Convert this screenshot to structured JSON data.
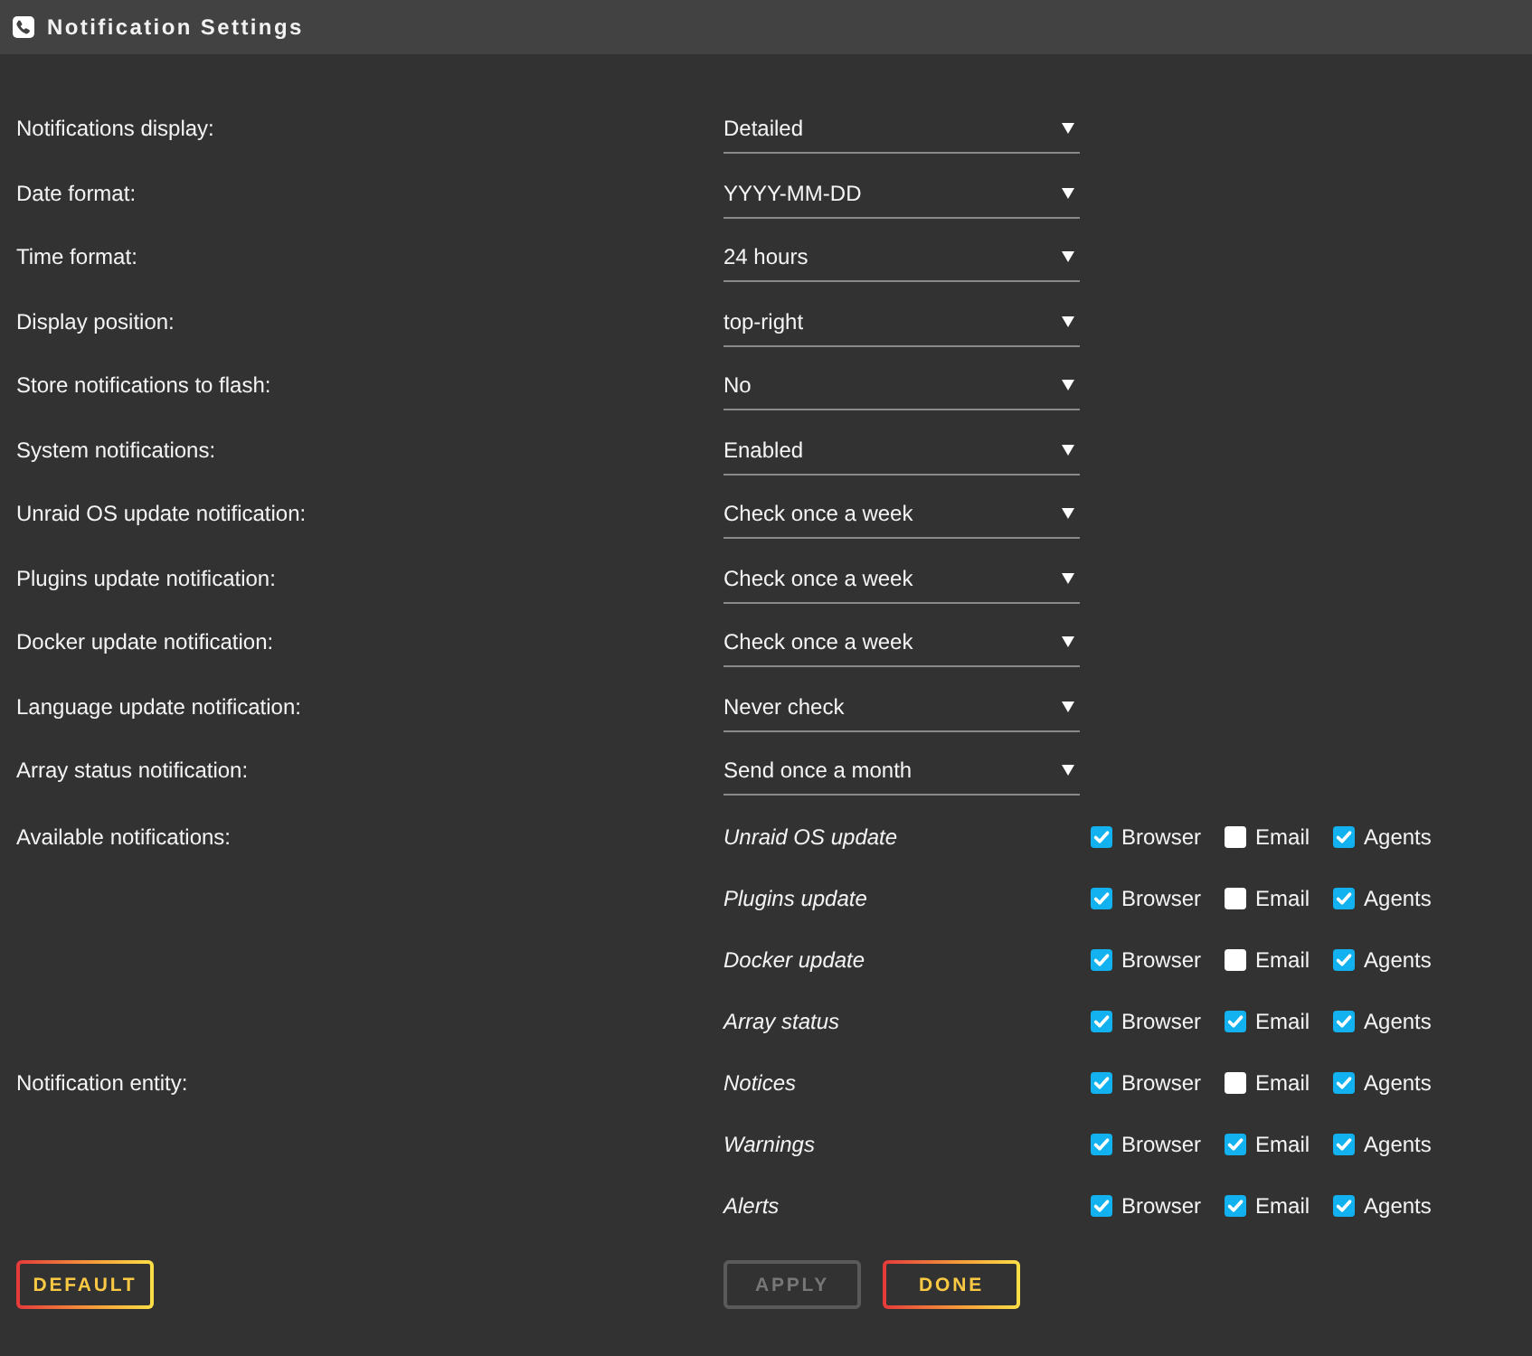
{
  "window": {
    "title": "Notification Settings"
  },
  "settings": [
    {
      "label": "Notifications display:",
      "value": "Detailed"
    },
    {
      "label": "Date format:",
      "value": "YYYY-MM-DD"
    },
    {
      "label": "Time format:",
      "value": "24 hours"
    },
    {
      "label": "Display position:",
      "value": "top-right"
    },
    {
      "label": "Store notifications to flash:",
      "value": "No"
    },
    {
      "label": "System notifications:",
      "value": "Enabled"
    },
    {
      "label": "Unraid OS update notification:",
      "value": "Check once a week"
    },
    {
      "label": "Plugins update notification:",
      "value": "Check once a week"
    },
    {
      "label": "Docker update notification:",
      "value": "Check once a week"
    },
    {
      "label": "Language update notification:",
      "value": "Never check"
    },
    {
      "label": "Array status notification:",
      "value": "Send once a month"
    }
  ],
  "groups": [
    {
      "label": "Available notifications:",
      "rows": [
        {
          "name": "Unraid OS update",
          "options": [
            {
              "label": "Browser",
              "checked": true
            },
            {
              "label": "Email",
              "checked": false
            },
            {
              "label": "Agents",
              "checked": true
            }
          ]
        },
        {
          "name": "Plugins update",
          "options": [
            {
              "label": "Browser",
              "checked": true
            },
            {
              "label": "Email",
              "checked": false
            },
            {
              "label": "Agents",
              "checked": true
            }
          ]
        },
        {
          "name": "Docker update",
          "options": [
            {
              "label": "Browser",
              "checked": true
            },
            {
              "label": "Email",
              "checked": false
            },
            {
              "label": "Agents",
              "checked": true
            }
          ]
        },
        {
          "name": "Array status",
          "options": [
            {
              "label": "Browser",
              "checked": true
            },
            {
              "label": "Email",
              "checked": true
            },
            {
              "label": "Agents",
              "checked": true
            }
          ]
        }
      ]
    },
    {
      "label": "Notification entity:",
      "rows": [
        {
          "name": "Notices",
          "options": [
            {
              "label": "Browser",
              "checked": true
            },
            {
              "label": "Email",
              "checked": false
            },
            {
              "label": "Agents",
              "checked": true
            }
          ]
        },
        {
          "name": "Warnings",
          "options": [
            {
              "label": "Browser",
              "checked": true
            },
            {
              "label": "Email",
              "checked": true
            },
            {
              "label": "Agents",
              "checked": true
            }
          ]
        },
        {
          "name": "Alerts",
          "options": [
            {
              "label": "Browser",
              "checked": true
            },
            {
              "label": "Email",
              "checked": true
            },
            {
              "label": "Agents",
              "checked": true
            }
          ]
        }
      ]
    }
  ],
  "footer": {
    "left": [
      {
        "label": "DEFAULT",
        "disabled": false
      }
    ],
    "right": [
      {
        "label": "APPLY",
        "disabled": true
      },
      {
        "label": "DONE",
        "disabled": false
      }
    ]
  }
}
